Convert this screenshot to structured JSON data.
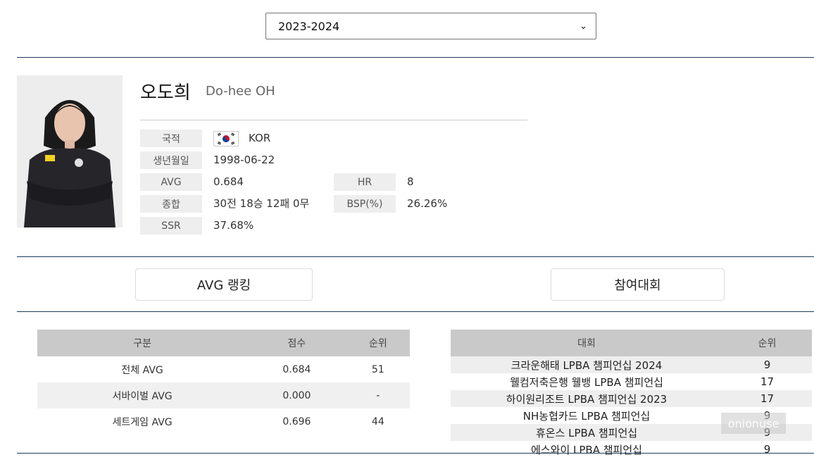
{
  "season_select": {
    "value": "2023-2024"
  },
  "player": {
    "name_kr": "오도희",
    "name_en": "Do-hee OH",
    "fields": {
      "nationality_label": "국적",
      "nationality_value": "KOR",
      "birth_label": "생년월일",
      "birth_value": "1998-06-22",
      "avg_label": "AVG",
      "avg_value": "0.684",
      "hr_label": "HR",
      "hr_value": "8",
      "record_label": "종합",
      "record_value": "30전 18승 12패 0무",
      "bsp_label": "BSP(%)",
      "bsp_value": "26.26%",
      "ssr_label": "SSR",
      "ssr_value": "37.68%"
    }
  },
  "tabs": {
    "avg_ranking": "AVG 랭킹",
    "tournaments": "참여대회"
  },
  "avg_table": {
    "headers": [
      "구분",
      "점수",
      "순위"
    ],
    "rows": [
      [
        "전체 AVG",
        "0.684",
        "51"
      ],
      [
        "서바이벌 AVG",
        "0.000",
        "-"
      ],
      [
        "세트게임 AVG",
        "0.696",
        "44"
      ]
    ]
  },
  "tour_table": {
    "headers": [
      "대회",
      "순위"
    ],
    "rows": [
      [
        "크라운해태 LPBA 챔피언십 2024",
        "9"
      ],
      [
        "웰컴저축은행 웰뱅 LPBA 챔피언십",
        "17"
      ],
      [
        "하이원리조트 LPBA 챔피언십 2023",
        "17"
      ],
      [
        "NH농협카드 LPBA 챔피언십",
        "9"
      ],
      [
        "휴온스 LPBA 챔피언십",
        "9"
      ],
      [
        "에스와이 LPBA 챔피언십",
        "9"
      ]
    ]
  },
  "watermark": "onionuse",
  "colors": {
    "rule": "#1f3a5f",
    "header_bg": "#c9c9c9",
    "label_bg": "#eeeeee"
  }
}
